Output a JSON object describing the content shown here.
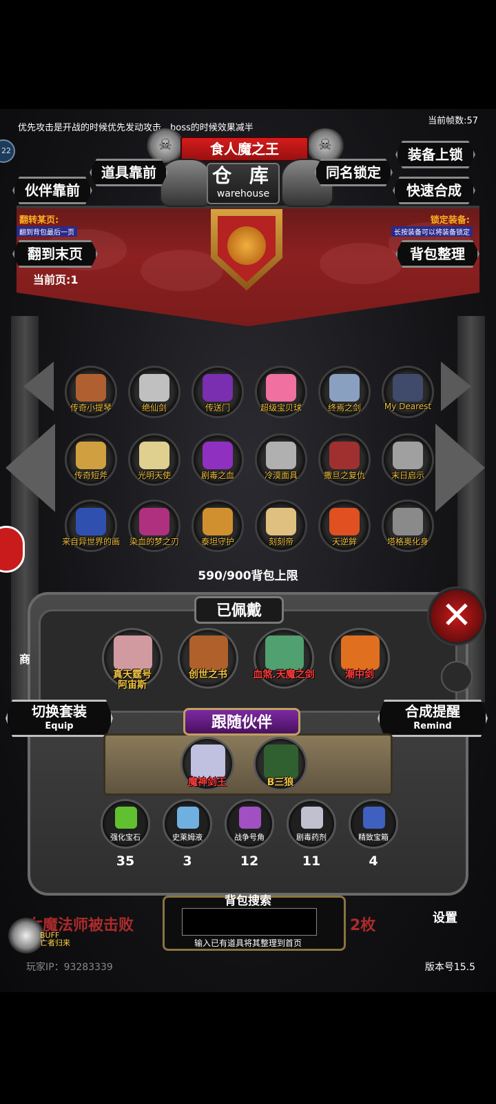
{
  "header": {
    "tip": "优先攻击是开战的时候优先发动攻击，boss的时候效果减半",
    "fps": "当前帧数:57",
    "side_badge": "22",
    "title": "食人魔之王",
    "warehouse_cn": "仓 库",
    "warehouse_en": "warehouse"
  },
  "buttons": {
    "prop_front": "道具靠前",
    "partner_front": "伙伴靠前",
    "same_name_lock": "同名锁定",
    "equip_lock": "装备上锁",
    "quick_merge": "快速合成",
    "to_last_page": "翻到末页",
    "bag_sort": "背包整理"
  },
  "bar": {
    "flip_label": "翻转某页:",
    "flip_sub": "翻到背包最后一页",
    "lock_label": "锁定装备:",
    "lock_sub": "长按装备可以将装备锁定",
    "current_page": "当前页:1"
  },
  "items": [
    {
      "name": "传奇小提琴",
      "color": "#b06030",
      "red": false
    },
    {
      "name": "绝仙剑",
      "color": "#c0c0c0",
      "red": false
    },
    {
      "name": "传送门",
      "color": "#7a2fb0",
      "red": false
    },
    {
      "name": "超级宝贝球",
      "color": "#f070a0",
      "red": false
    },
    {
      "name": "终焉之剑",
      "color": "#8aa0c0",
      "red": false
    },
    {
      "name": "My Dearest",
      "color": "#404a6a",
      "red": false
    },
    {
      "name": "传奇短斧",
      "color": "#d0a040",
      "red": false
    },
    {
      "name": "光明天使",
      "color": "#e0d090",
      "red": false
    },
    {
      "name": "剧毒之血",
      "color": "#9030c0",
      "red": false
    },
    {
      "name": "冷漠面具",
      "color": "#b0b0b0",
      "red": false
    },
    {
      "name": "撒旦之复仇",
      "color": "#a03030",
      "red": false
    },
    {
      "name": "末日启示",
      "color": "#a0a0a0",
      "red": false
    },
    {
      "name": "来自异世界的画",
      "color": "#3050b0",
      "red": false
    },
    {
      "name": "染血的梦之刃",
      "color": "#b03080",
      "red": false
    },
    {
      "name": "泰坦守护",
      "color": "#d09030",
      "red": false
    },
    {
      "name": "刻刻帝",
      "color": "#e0c080",
      "red": false
    },
    {
      "name": "天逆鉾",
      "color": "#e05020",
      "red": false
    },
    {
      "name": "塔格奥化身",
      "color": "#8a8a8a",
      "red": false
    }
  ],
  "capacity": "590/900背包上限",
  "equipped": {
    "title": "已佩戴",
    "items": [
      {
        "name": "真天霆号\n阿宙斯",
        "color": "#d09aa0",
        "red": false
      },
      {
        "name": "创世之书",
        "color": "#b0602a",
        "red": false
      },
      {
        "name": "血煞.天魔之剑",
        "color": "#50a070",
        "red": true
      },
      {
        "name": "潮中剑",
        "color": "#e07020",
        "red": true
      }
    ]
  },
  "switch_set": {
    "cn": "切换套装",
    "en": "Equip"
  },
  "merge_remind": {
    "cn": "合成提醒",
    "en": "Remind"
  },
  "follow": {
    "title": "跟随伙伴",
    "partners": [
      {
        "name": "魔神剑王",
        "color": "#c0c0e0",
        "red": true
      },
      {
        "name": "B三狼",
        "color": "#306030",
        "red": false
      }
    ]
  },
  "resources": [
    {
      "name": "强化宝石",
      "count": "35",
      "color": "#60c030"
    },
    {
      "name": "史莱姆液",
      "count": "3",
      "color": "#70b0e0"
    },
    {
      "name": "战争号角",
      "count": "12",
      "color": "#a050c0"
    },
    {
      "name": "剧毒药剂",
      "count": "11",
      "color": "#c0c0d0"
    },
    {
      "name": "精致宝箱",
      "count": "4",
      "color": "#4060c0"
    }
  ],
  "search": {
    "title": "背包搜索",
    "value": "",
    "hint": "输入已有道具将其整理到首页"
  },
  "footer": {
    "log_left": "女魔法师被击败",
    "log_right": "2枚",
    "ip": "玩家IP：93283339",
    "version": "版本号15.5",
    "buff": "BUFF",
    "buff_sub": "亡者归来",
    "settings": "设置",
    "shop": "商"
  }
}
